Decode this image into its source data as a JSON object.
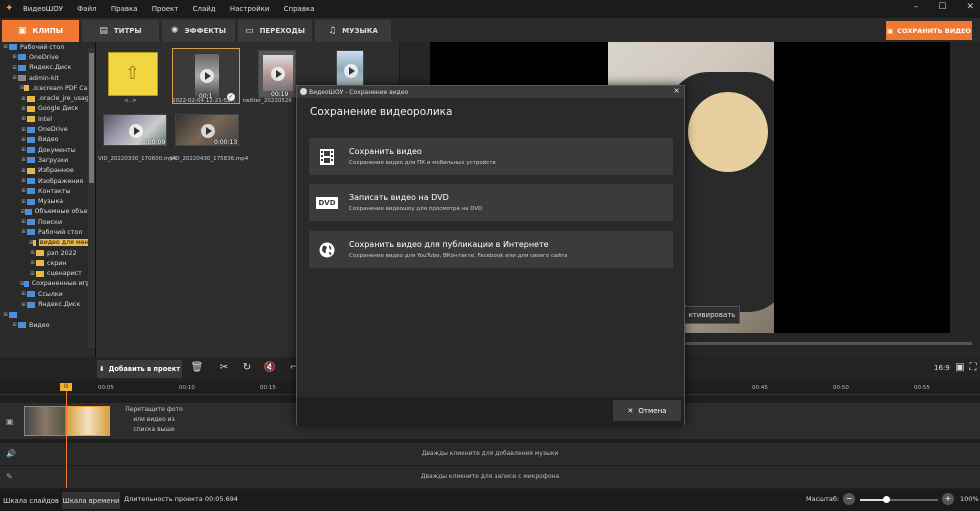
{
  "app": {
    "title": "ВидеоШОУ",
    "menu": [
      "Файл",
      "Правка",
      "Проект",
      "Слайд",
      "Настройки",
      "Справка"
    ]
  },
  "tabs": [
    {
      "label": "КЛИПЫ",
      "icon": "film-icon",
      "active": true
    },
    {
      "label": "ТИТРЫ",
      "icon": "text-icon",
      "active": false
    },
    {
      "label": "ЭФФЕКТЫ",
      "icon": "effects-icon",
      "active": false
    },
    {
      "label": "ПЕРЕХОДЫ",
      "icon": "transition-icon",
      "active": false
    },
    {
      "label": "МУЗЫКА",
      "icon": "music-icon",
      "active": false
    }
  ],
  "save_video_button": "СОХРАНИТЬ ВИДЕО",
  "tree": [
    {
      "label": "Рабочий стол",
      "indent": 0,
      "icon": "blue"
    },
    {
      "label": "OneDrive",
      "indent": 1,
      "icon": "blue"
    },
    {
      "label": "Яндекс.Диск",
      "indent": 1,
      "icon": "blue"
    },
    {
      "label": "admin-kit",
      "indent": 1,
      "icon": "grey"
    },
    {
      "label": ".Icecream PDF Canc",
      "indent": 2,
      "icon": "yellow"
    },
    {
      "label": ".oracle_jre_usage",
      "indent": 2,
      "icon": "yellow"
    },
    {
      "label": "Google Диск",
      "indent": 2,
      "icon": "yellow"
    },
    {
      "label": "Intel",
      "indent": 2,
      "icon": "yellow"
    },
    {
      "label": "OneDrive",
      "indent": 2,
      "icon": "blue"
    },
    {
      "label": "Видео",
      "indent": 2,
      "icon": "blue"
    },
    {
      "label": "Документы",
      "indent": 2,
      "icon": "blue"
    },
    {
      "label": "Загрузки",
      "indent": 2,
      "icon": "blue"
    },
    {
      "label": "Избранное",
      "indent": 2,
      "icon": "yellow"
    },
    {
      "label": "Изображения",
      "indent": 2,
      "icon": "blue"
    },
    {
      "label": "Контакты",
      "indent": 2,
      "icon": "blue"
    },
    {
      "label": "Музыка",
      "indent": 2,
      "icon": "blue"
    },
    {
      "label": "Объемные объект",
      "indent": 2,
      "icon": "blue"
    },
    {
      "label": "Поиски",
      "indent": 2,
      "icon": "blue"
    },
    {
      "label": "Рабочий стол",
      "indent": 2,
      "icon": "blue"
    },
    {
      "label": "видео для меню",
      "indent": 3,
      "icon": "yellow",
      "highlight": true
    },
    {
      "label": "рэп 2022",
      "indent": 3,
      "icon": "yellow"
    },
    {
      "label": "скрин",
      "indent": 3,
      "icon": "yellow"
    },
    {
      "label": "сценарист",
      "indent": 3,
      "icon": "yellow"
    },
    {
      "label": "Сохраненные игры",
      "indent": 2,
      "icon": "blue"
    },
    {
      "label": "Ссылки",
      "indent": 2,
      "icon": "blue"
    },
    {
      "label": "Яндекс.Диск",
      "indent": 2,
      "icon": "blue"
    },
    {
      "label": "",
      "indent": 0,
      "icon": "blue"
    },
    {
      "label": "Видео",
      "indent": 1,
      "icon": "blue"
    }
  ],
  "clips": {
    "up_label": "<..>",
    "items": [
      {
        "caption": "2022-02-04 12-21-52...",
        "duration": "00:1",
        "checked": true
      },
      {
        "caption": "twitter_20220526",
        "duration": "00:19"
      },
      {
        "caption": "",
        "duration": ""
      },
      {
        "caption": "VID_20220330_170600.mp4",
        "duration": "0:00:09"
      },
      {
        "caption": "VID_20220430_175836.mp4",
        "duration": "0:00:13"
      }
    ]
  },
  "preview": {
    "activate_label": "ктивировать",
    "ratio": "16:9"
  },
  "toolbar": {
    "add_to_project": "Добавить в проект"
  },
  "ruler": [
    "00:05",
    "00:10",
    "00:15",
    "00:45",
    "00:50",
    "00:55"
  ],
  "timeline": {
    "drop_hint": "Перетащите фото или видео из списка выше",
    "music_hint": "Дважды кликните для добавления музыки",
    "mic_hint": "Дважды кликните для записи с микрофона"
  },
  "statusbar": {
    "slides_tab": "Шкала слайдов",
    "timeline_tab": "Шкала времени",
    "duration": "Длительность проекта 00:05.694",
    "zoom_label": "Масштаб:",
    "zoom_value": 0.33,
    "zoom_pct": "100%"
  },
  "dialog": {
    "window_title": "ВидеоШОУ - Сохранение видео",
    "heading": "Сохранение видеоролика",
    "options": [
      {
        "title": "Сохранить видео",
        "subtitle": "Сохранение видео для ПК и мобильных устройств",
        "icon": "film-strip-icon"
      },
      {
        "title": "Записать видео на DVD",
        "subtitle": "Сохранение видеошоу для просмотра на DVD",
        "icon": "dvd-icon",
        "icon_text": "DVD"
      },
      {
        "title": "Сохранить видео для публикации в Интернете",
        "subtitle": "Сохранение видео для YouTube, ВКонтакте, Facebook или для своего сайта",
        "icon": "globe-icon"
      }
    ],
    "cancel": "Отмена"
  },
  "colors": {
    "accent": "#f07830",
    "folder": "#e8b84a"
  }
}
